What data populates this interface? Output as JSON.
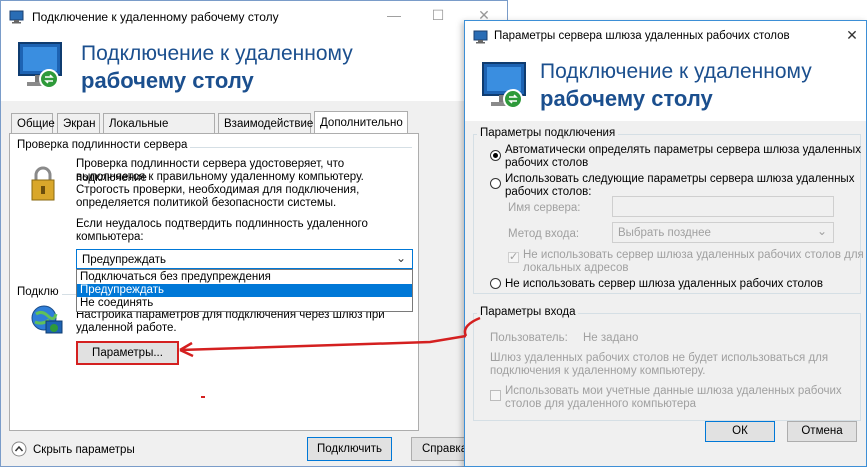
{
  "main": {
    "title": "Подключение к удаленному рабочему столу",
    "window_controls": {
      "minimize": "—",
      "maximize": "☐",
      "close": "✕"
    },
    "header_line1": "Подключение к удаленному",
    "header_line2": "рабочему столу",
    "tabs": [
      "Общие",
      "Экран",
      "Локальные ресурсы",
      "Взаимодействие",
      "Дополнительно"
    ],
    "server_auth": {
      "group_label": "Проверка подлинности сервера",
      "desc1": "Проверка подлинности сервера удостоверяет, что подключение",
      "desc2": "выполняется к правильному удаленному компьютеру.",
      "desc3": "Строгость проверки, необходимая для подключения,",
      "desc4": "определяется политикой безопасности системы.",
      "fail_label1": "Если неудалось подтвердить подлинность удаленного",
      "fail_label2": "компьютера:",
      "combo_value": "Предупреждать",
      "options": [
        "Подключаться без предупреждения",
        "Предупреждать",
        "Не соединять"
      ]
    },
    "connect_anywhere": {
      "group_label": "Подклю",
      "desc1": "Настройка параметров для подключения через шлюз при",
      "desc2": "удаленной работе.",
      "settings_button": "Параметры..."
    },
    "hide_options": "Скрыть параметры",
    "connect_button": "Подключить",
    "help_button": "Справка"
  },
  "dialog": {
    "title": "Параметры сервера шлюза удаленных рабочих столов",
    "close": "✕",
    "header_line1": "Подключение к удаленному",
    "header_line2": "рабочему столу",
    "conn_group": "Параметры подключения",
    "radio_auto1": "Автоматически определять параметры сервера шлюза удаленных",
    "radio_auto2": "рабочих столов",
    "radio_manual1": "Использовать следующие параметры сервера шлюза удаленных",
    "radio_manual2": "рабочих столов:",
    "server_name_label": "Имя сервера:",
    "logon_method_label": "Метод входа:",
    "logon_method_value": "Выбрать позднее",
    "bypass1": "Не использовать сервер шлюза удаленных рабочих столов для",
    "bypass2": "локальных адресов",
    "radio_none": "Не использовать сервер шлюза удаленных рабочих столов",
    "logon_group": "Параметры входа",
    "user_label": "Пользователь:",
    "user_value": "Не задано",
    "info1": "Шлюз удаленных рабочих столов не будет использоваться для",
    "info2": "подключения к удаленному компьютеру.",
    "use_creds1": "Использовать мои учетные данные шлюза удаленных рабочих",
    "use_creds2": "столов для удаленного компьютера",
    "ok": "ОК",
    "cancel": "Отмена"
  },
  "annotation_color": "#d42020"
}
